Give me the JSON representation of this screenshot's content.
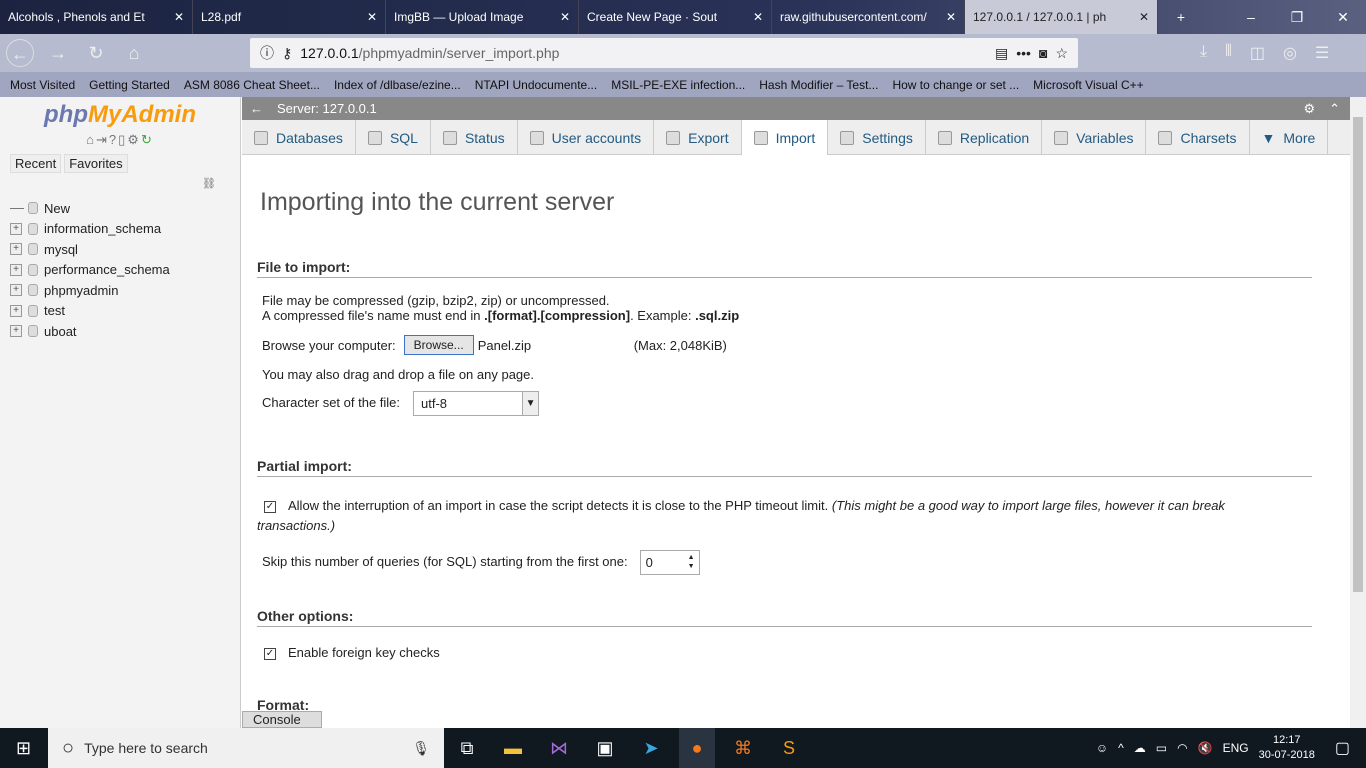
{
  "browser": {
    "tabs": [
      {
        "title": "Alcohols , Phenols and Et"
      },
      {
        "title": "L28.pdf"
      },
      {
        "title": "ImgBB — Upload Image"
      },
      {
        "title": "Create New Page · Sout"
      },
      {
        "title": "raw.githubusercontent.com/"
      },
      {
        "title": "127.0.0.1 / 127.0.0.1 | ph",
        "active": true
      }
    ],
    "url_host": "127.0.0.1",
    "url_path": "/phpmyadmin/server_import.php",
    "bookmarks": [
      "Most Visited",
      "Getting Started",
      "ASM 8086 Cheat Sheet...",
      "Index of /dlbase/ezine...",
      "NTAPI Undocumente...",
      "MSIL-PE-EXE infection...",
      "Hash Modifier – Test...",
      "How to change or set ...",
      "Microsoft Visual C++"
    ]
  },
  "sidebar": {
    "logo": {
      "a": "php",
      "b": "MyAdmin"
    },
    "recent": "Recent",
    "favorites": "Favorites",
    "new": "New",
    "databases": [
      "information_schema",
      "mysql",
      "performance_schema",
      "phpmyadmin",
      "test",
      "uboat"
    ]
  },
  "topbar": {
    "server": "Server: 127.0.0.1"
  },
  "menu": [
    {
      "label": "Databases"
    },
    {
      "label": "SQL"
    },
    {
      "label": "Status"
    },
    {
      "label": "User accounts"
    },
    {
      "label": "Export"
    },
    {
      "label": "Import",
      "active": true
    },
    {
      "label": "Settings"
    },
    {
      "label": "Replication"
    },
    {
      "label": "Variables"
    },
    {
      "label": "Charsets"
    },
    {
      "label": "More"
    }
  ],
  "main": {
    "title": "Importing into the current server",
    "file": {
      "heading": "File to import:",
      "line1": "File may be compressed (gzip, bzip2, zip) or uncompressed.",
      "line2a": "A compressed file's name must end in ",
      "line2b": ".[format].[compression]",
      "line2c": ". Example: ",
      "line2d": ".sql.zip",
      "browse_label": "Browse your computer:",
      "browse_button": "Browse...",
      "file_name": "Panel.zip",
      "max": "(Max: 2,048KiB)",
      "drag": "You may also drag and drop a file on any page.",
      "charset_label": "Character set of the file:",
      "charset": "utf-8"
    },
    "partial": {
      "heading": "Partial import:",
      "allow": "Allow the interruption of an import in case the script detects it is close to the PHP timeout limit.",
      "allow_note": "(This might be a good way to import large files, however it can break transactions.)",
      "allow_checked": true,
      "skip_label": "Skip this number of queries (for SQL) starting from the first one:",
      "skip_value": "0"
    },
    "other": {
      "heading": "Other options:",
      "fk": "Enable foreign key checks",
      "fk_checked": true
    },
    "format": {
      "heading": "Format:"
    }
  },
  "console": "Console",
  "taskbar": {
    "search_placeholder": "Type here to search",
    "lang": "ENG",
    "time": "12:17",
    "date": "30-07-2018"
  }
}
